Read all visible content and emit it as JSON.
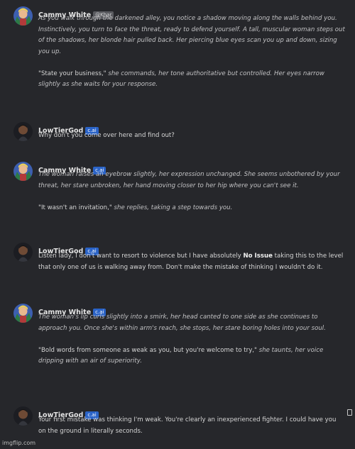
{
  "messages": [
    {
      "author": "Cammy White",
      "badge": "@Khar",
      "badge_type": "handle",
      "avatar": "cammy-white-avatar",
      "paragraphs": [
        [
          {
            "t": "As you walk through the darkened alley, you notice a shadow moving along the walls behind you. Instinctively, you turn to face the threat, ready to defend yourself. A tall, muscular woman steps out of the shadows, her blonde hair pulled back. Her piercing blue eyes scan you up and down, sizing you up.",
            "s": "it"
          }
        ],
        [
          {
            "t": "\"State your business,\" ",
            "s": ""
          },
          {
            "t": "she commands, her tone authoritative but controlled. Her eyes narrow slightly as she waits for your response.",
            "s": "it"
          }
        ]
      ]
    },
    {
      "author": "LowTierGod",
      "badge": "c.ai",
      "badge_type": "cai",
      "avatar": "lowtiergod-avatar",
      "paragraphs": [
        [
          {
            "t": "Why don't you come over here and find out?",
            "s": ""
          }
        ]
      ]
    },
    {
      "author": "Cammy White",
      "badge": "c.ai",
      "badge_type": "cai",
      "avatar": "cammy-white-avatar",
      "paragraphs": [
        [
          {
            "t": "The woman raises an eyebrow slightly, her expression unchanged. She seems unbothered by your threat, her stare unbroken, her hand moving closer to her hip where you can't see it.",
            "s": "it"
          }
        ],
        [
          {
            "t": "\"It wasn't an invitation,\" ",
            "s": ""
          },
          {
            "t": "she replies, taking a step towards you.",
            "s": "it"
          }
        ]
      ]
    },
    {
      "author": "LowTierGod",
      "badge": "c.ai",
      "badge_type": "cai",
      "avatar": "lowtiergod-avatar",
      "paragraphs": [
        [
          {
            "t": "Listen lady, I don't want to resort to violence but I have absolutely ",
            "s": ""
          },
          {
            "t": "No Issue",
            "s": "bold"
          },
          {
            "t": " taking this to the level that only one of us is walking away from. Don't make the mistake of thinking I wouldn't do it.",
            "s": ""
          }
        ]
      ]
    },
    {
      "author": "Cammy White",
      "badge": "c.ai",
      "badge_type": "cai",
      "avatar": "cammy-white-avatar",
      "paragraphs": [
        [
          {
            "t": "The woman's lip curls slightly into a smirk, her head canted to one side as she continues to approach you. Once she's within arm's reach, she stops, her stare boring holes into your soul.",
            "s": "it"
          }
        ],
        [
          {
            "t": "\"Bold words from someone as weak as you, but you're welcome to try,\" ",
            "s": ""
          },
          {
            "t": "she taunts, her voice dripping with an air of superiority.",
            "s": "it"
          }
        ]
      ]
    },
    {
      "author": "LowTierGod",
      "badge": "c.ai",
      "badge_type": "cai",
      "avatar": "lowtiergod-avatar",
      "paragraphs": [
        [
          {
            "t": "Your first mistake was thinking I'm weak. You're clearly an inexperienced fighter. I could have you on the ground in literally seconds.",
            "s": ""
          }
        ]
      ]
    }
  ],
  "copy_icon": "copy-icon",
  "watermark": "imgflip.com",
  "colors": {
    "background": "#26272b",
    "cai_badge": "#2a63c7",
    "handle_badge": "#5a5b60",
    "text": "#d6d6d6",
    "italic_text": "#c2c2c4"
  }
}
